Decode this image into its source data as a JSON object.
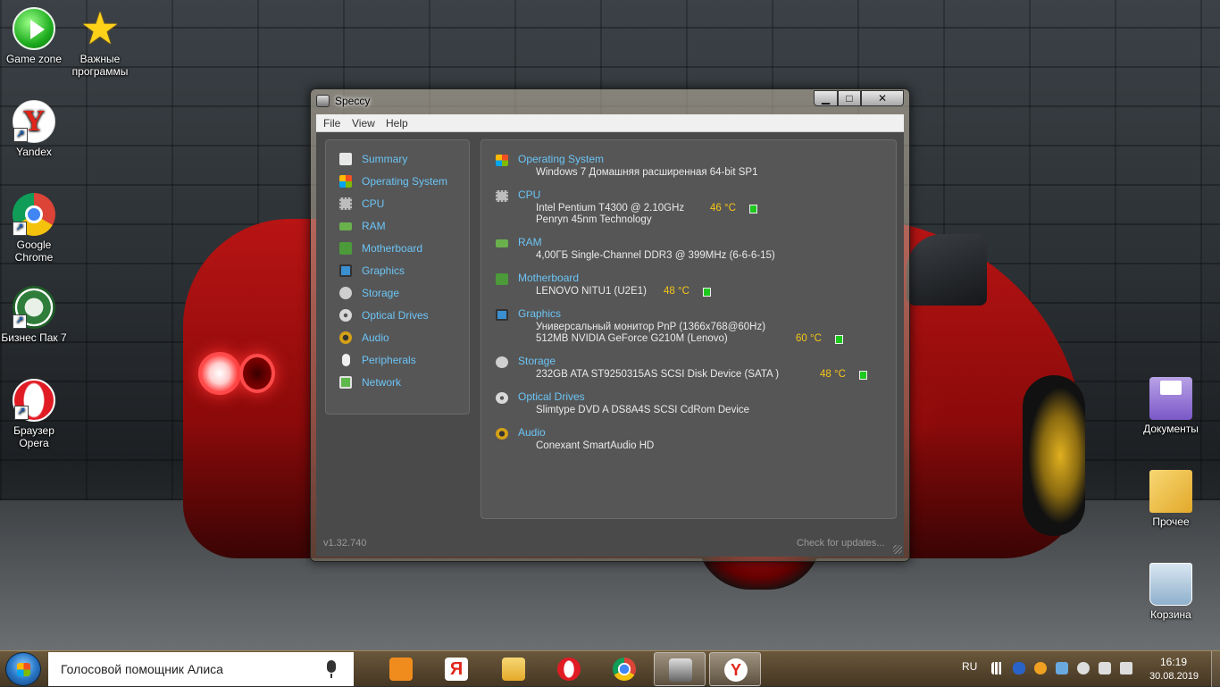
{
  "desktop": {
    "icons_left": [
      {
        "label": "Game zone"
      },
      {
        "label": "Важные программы"
      },
      {
        "label": "Yandex"
      },
      {
        "label": "Google Chrome"
      },
      {
        "label": "Бизнес Пак 7"
      },
      {
        "label": "Браузер Opera"
      }
    ],
    "icons_right": [
      {
        "label": "Документы"
      },
      {
        "label": "Прочее"
      },
      {
        "label": "Корзина"
      }
    ]
  },
  "window": {
    "title": "Speccy",
    "controls": {
      "minimize": "▁",
      "maximize": "□",
      "close": "✕"
    },
    "menu": [
      "File",
      "View",
      "Help"
    ],
    "sidebar": [
      {
        "label": "Summary",
        "icon": "summary-icon",
        "color": "#e8e8e8"
      },
      {
        "label": "Operating System",
        "icon": "windows-icon",
        "color": "#f2a51c"
      },
      {
        "label": "CPU",
        "icon": "cpu-icon",
        "color": "#bdbdbd"
      },
      {
        "label": "RAM",
        "icon": "ram-icon",
        "color": "#6ab04c"
      },
      {
        "label": "Motherboard",
        "icon": "motherboard-icon",
        "color": "#4c9a3a"
      },
      {
        "label": "Graphics",
        "icon": "monitor-icon",
        "color": "#3a8fd1"
      },
      {
        "label": "Storage",
        "icon": "hdd-icon",
        "color": "#cfcfcf"
      },
      {
        "label": "Optical Drives",
        "icon": "disc-icon",
        "color": "#d8d8d8"
      },
      {
        "label": "Audio",
        "icon": "speaker-icon",
        "color": "#d4a017"
      },
      {
        "label": "Peripherals",
        "icon": "mouse-icon",
        "color": "#efefef"
      },
      {
        "label": "Network",
        "icon": "network-icon",
        "color": "#5fb84a"
      }
    ],
    "summary": {
      "os": {
        "title": "Operating System",
        "line1": "Windows 7 Домашняя расширенная 64-bit SP1"
      },
      "cpu": {
        "title": "CPU",
        "line1": "Intel Pentium T4300 @ 2.10GHz",
        "temp": "46 °C",
        "line2": "Penryn 45nm Technology"
      },
      "ram": {
        "title": "RAM",
        "line1": "4,00ГБ Single-Channel DDR3 @ 399MHz (6-6-6-15)"
      },
      "motherboard": {
        "title": "Motherboard",
        "line1": "LENOVO NITU1 (U2E1)",
        "temp": "48 °C"
      },
      "graphics": {
        "title": "Graphics",
        "line1": "Универсальный монитор PnP (1366x768@60Hz)",
        "line2": "512MB NVIDIA GeForce G210M (Lenovo)",
        "temp": "60 °C"
      },
      "storage": {
        "title": "Storage",
        "line1": "232GB ATA ST9250315AS SCSI Disk Device (SATA )",
        "temp": "48 °C"
      },
      "optical": {
        "title": "Optical Drives",
        "line1": "Slimtype DVD A DS8A4S SCSI CdRom Device"
      },
      "audio": {
        "title": "Audio",
        "line1": "Conexant SmartAudio HD"
      }
    },
    "status": {
      "version": "v1.32.740",
      "update": "Check for updates..."
    }
  },
  "taskbar": {
    "search_text": "Голосовой помощник Алиса",
    "apps": [
      {
        "name": "media-player",
        "color": "#f08c1e",
        "active": false
      },
      {
        "name": "yandex-browser",
        "color": "#e0261b",
        "active": false
      },
      {
        "name": "file-explorer",
        "color": "#f2c94c",
        "active": false
      },
      {
        "name": "opera",
        "color": "#e01b24",
        "active": false
      },
      {
        "name": "chrome",
        "color": "#4285f4",
        "active": false
      },
      {
        "name": "speccy",
        "color": "#9a9a9a",
        "active": true
      },
      {
        "name": "yandex",
        "color": "#e0261b",
        "active": true
      }
    ],
    "lang": "RU",
    "time": "16:19",
    "date": "30.08.2019"
  }
}
